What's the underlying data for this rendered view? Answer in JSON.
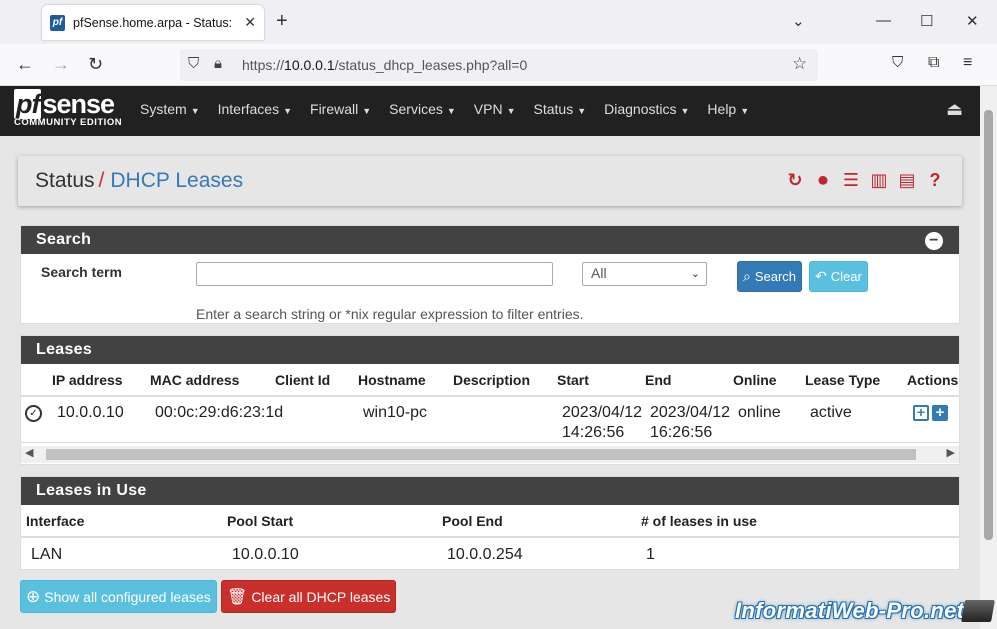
{
  "browser": {
    "tab_title": "pfSense.home.arpa - Status: DHCP Leases",
    "url_prefix": "https://",
    "url_host": "10.0.0.1",
    "url_path": "/status_dhcp_leases.php?all=0"
  },
  "header": {
    "logo_pf": "pf",
    "logo_sense": "sense",
    "logo_sub": "COMMUNITY EDITION",
    "menu": [
      "System",
      "Interfaces",
      "Firewall",
      "Services",
      "VPN",
      "Status",
      "Diagnostics",
      "Help"
    ]
  },
  "breadcrumb": {
    "parent": "Status",
    "separator": "/",
    "current": "DHCP Leases"
  },
  "search_panel": {
    "title": "Search",
    "label": "Search term",
    "input_value": "",
    "select_value": "All",
    "search_button": "Search",
    "clear_button": "Clear",
    "help_text": "Enter a search string or *nix regular expression to filter entries."
  },
  "leases_panel": {
    "title": "Leases",
    "columns": [
      "IP address",
      "MAC address",
      "Client Id",
      "Hostname",
      "Description",
      "Start",
      "End",
      "Online",
      "Lease Type",
      "Actions"
    ],
    "rows": [
      {
        "ip": "10.0.0.10",
        "mac": "00:0c:29:d6:23:1d",
        "client_id": "",
        "hostname": "win10-pc",
        "description": "",
        "start_date": "2023/04/12",
        "start_time": "14:26:56",
        "end_date": "2023/04/12",
        "end_time": "16:26:56",
        "online": "online",
        "lease_type": "active"
      }
    ]
  },
  "in_use_panel": {
    "title": "Leases in Use",
    "columns": [
      "Interface",
      "Pool Start",
      "Pool End",
      "# of leases in use"
    ],
    "rows": [
      {
        "interface": "LAN",
        "pool_start": "10.0.0.10",
        "pool_end": "10.0.0.254",
        "count": "1"
      }
    ]
  },
  "buttons": {
    "show_all": "Show all configured leases",
    "clear_all": "Clear all DHCP leases"
  },
  "watermark": "InformatiWeb-Pro.net",
  "colors": {
    "header_bg": "#212121",
    "panel_heading": "#424242",
    "link_blue": "#337ab7",
    "danger_red": "#c9302c",
    "info_cyan": "#5bc0de"
  }
}
